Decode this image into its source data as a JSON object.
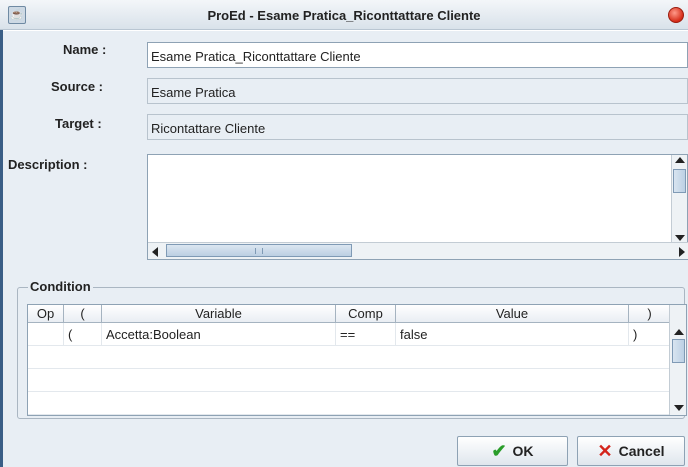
{
  "window": {
    "title": "ProEd - Esame Pratica_Riconttattare Cliente"
  },
  "form": {
    "name_label": "Name :",
    "name_value": "Esame Pratica_Riconttattare Cliente",
    "source_label": "Source :",
    "source_value": "Esame Pratica",
    "target_label": "Target :",
    "target_value": "Ricontattare Cliente",
    "description_label": "Description :",
    "description_value": ""
  },
  "condition": {
    "title": "Condition",
    "columns": [
      "Op",
      "(",
      "Variable",
      "Comp",
      "Value",
      ")"
    ],
    "rows": [
      {
        "op": "",
        "open": "(",
        "variable": "Accetta:Boolean",
        "comp": "==",
        "value": "false",
        "close": ")"
      }
    ]
  },
  "buttons": {
    "ok": "OK",
    "cancel": "Cancel"
  },
  "colors": {
    "panel_bg": "#e8eef4",
    "ok_check": "#2a9d2a",
    "cancel_x": "#d4241b",
    "close_red": "#d52b17"
  }
}
